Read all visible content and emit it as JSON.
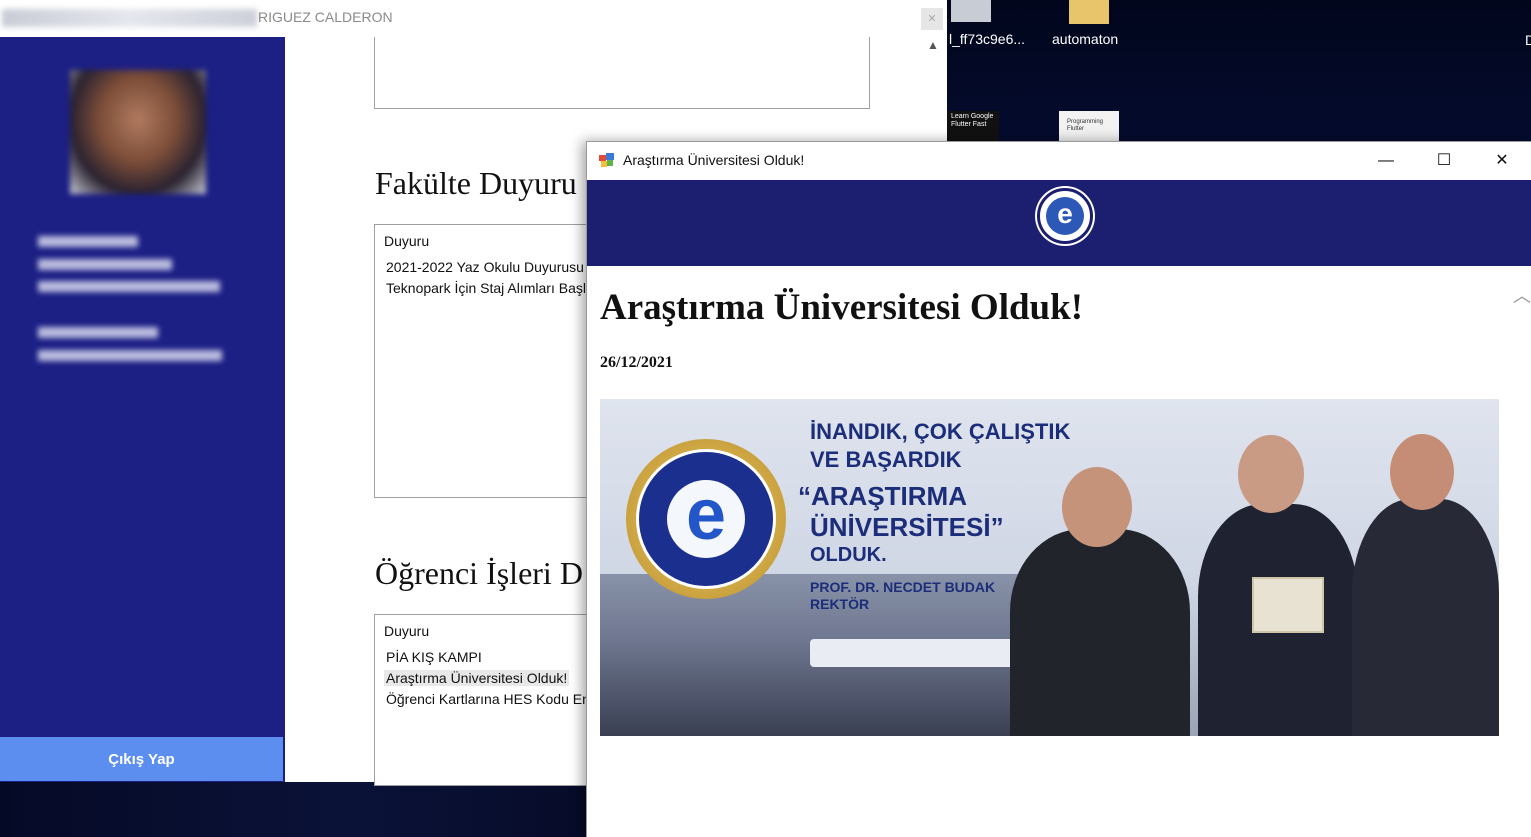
{
  "main_window": {
    "title": "RIGUEZ CALDERON",
    "sidebar": {
      "logout_label": "Çıkış Yap"
    },
    "sections": [
      {
        "title": "Fakülte Duyuru",
        "column_header": "Duyuru",
        "items": [
          "2021-2022 Yaz Okulu Duyurusu",
          "Teknopark İçin Staj Alımları Başlam"
        ]
      },
      {
        "title": "Öğrenci İşleri D",
        "column_header": "Duyuru",
        "items": [
          "PİA KIŞ KAMPI",
          "Araştırma Üniversitesi Olduk!",
          "Öğrenci Kartlarına HES Kodu Ente"
        ],
        "selected_index": 1
      }
    ]
  },
  "desktop": {
    "icons": [
      "l_ff73c9e6...",
      "automaton"
    ],
    "thumb_labels": [
      "Learn Google Flutter Fast",
      "Programming Flutter"
    ]
  },
  "popup": {
    "window_title": "Araştırma Üniversitesi Olduk!",
    "logo_letter": "e",
    "article_title": "Araştırma Üniversitesi Olduk!",
    "date": "26/12/2021",
    "banner": {
      "line1": "İNANDIK, ÇOK ÇALIŞTIK",
      "line2": "VE BAŞARDIK",
      "quote1": "“ARAŞTIRMA",
      "quote2": "ÜNİVERSİTESİ”",
      "line3": "OLDUK.",
      "signer": "PROF. DR. NECDET BUDAK",
      "signer_role": "REKTÖR",
      "logo_letter": "e"
    },
    "controls": {
      "minimize": "—",
      "maximize": "☐",
      "close": "✕"
    }
  },
  "colors": {
    "sidebar": "#1c1f84",
    "logout": "#5c8ef0",
    "popup_header": "#1c1f70"
  }
}
